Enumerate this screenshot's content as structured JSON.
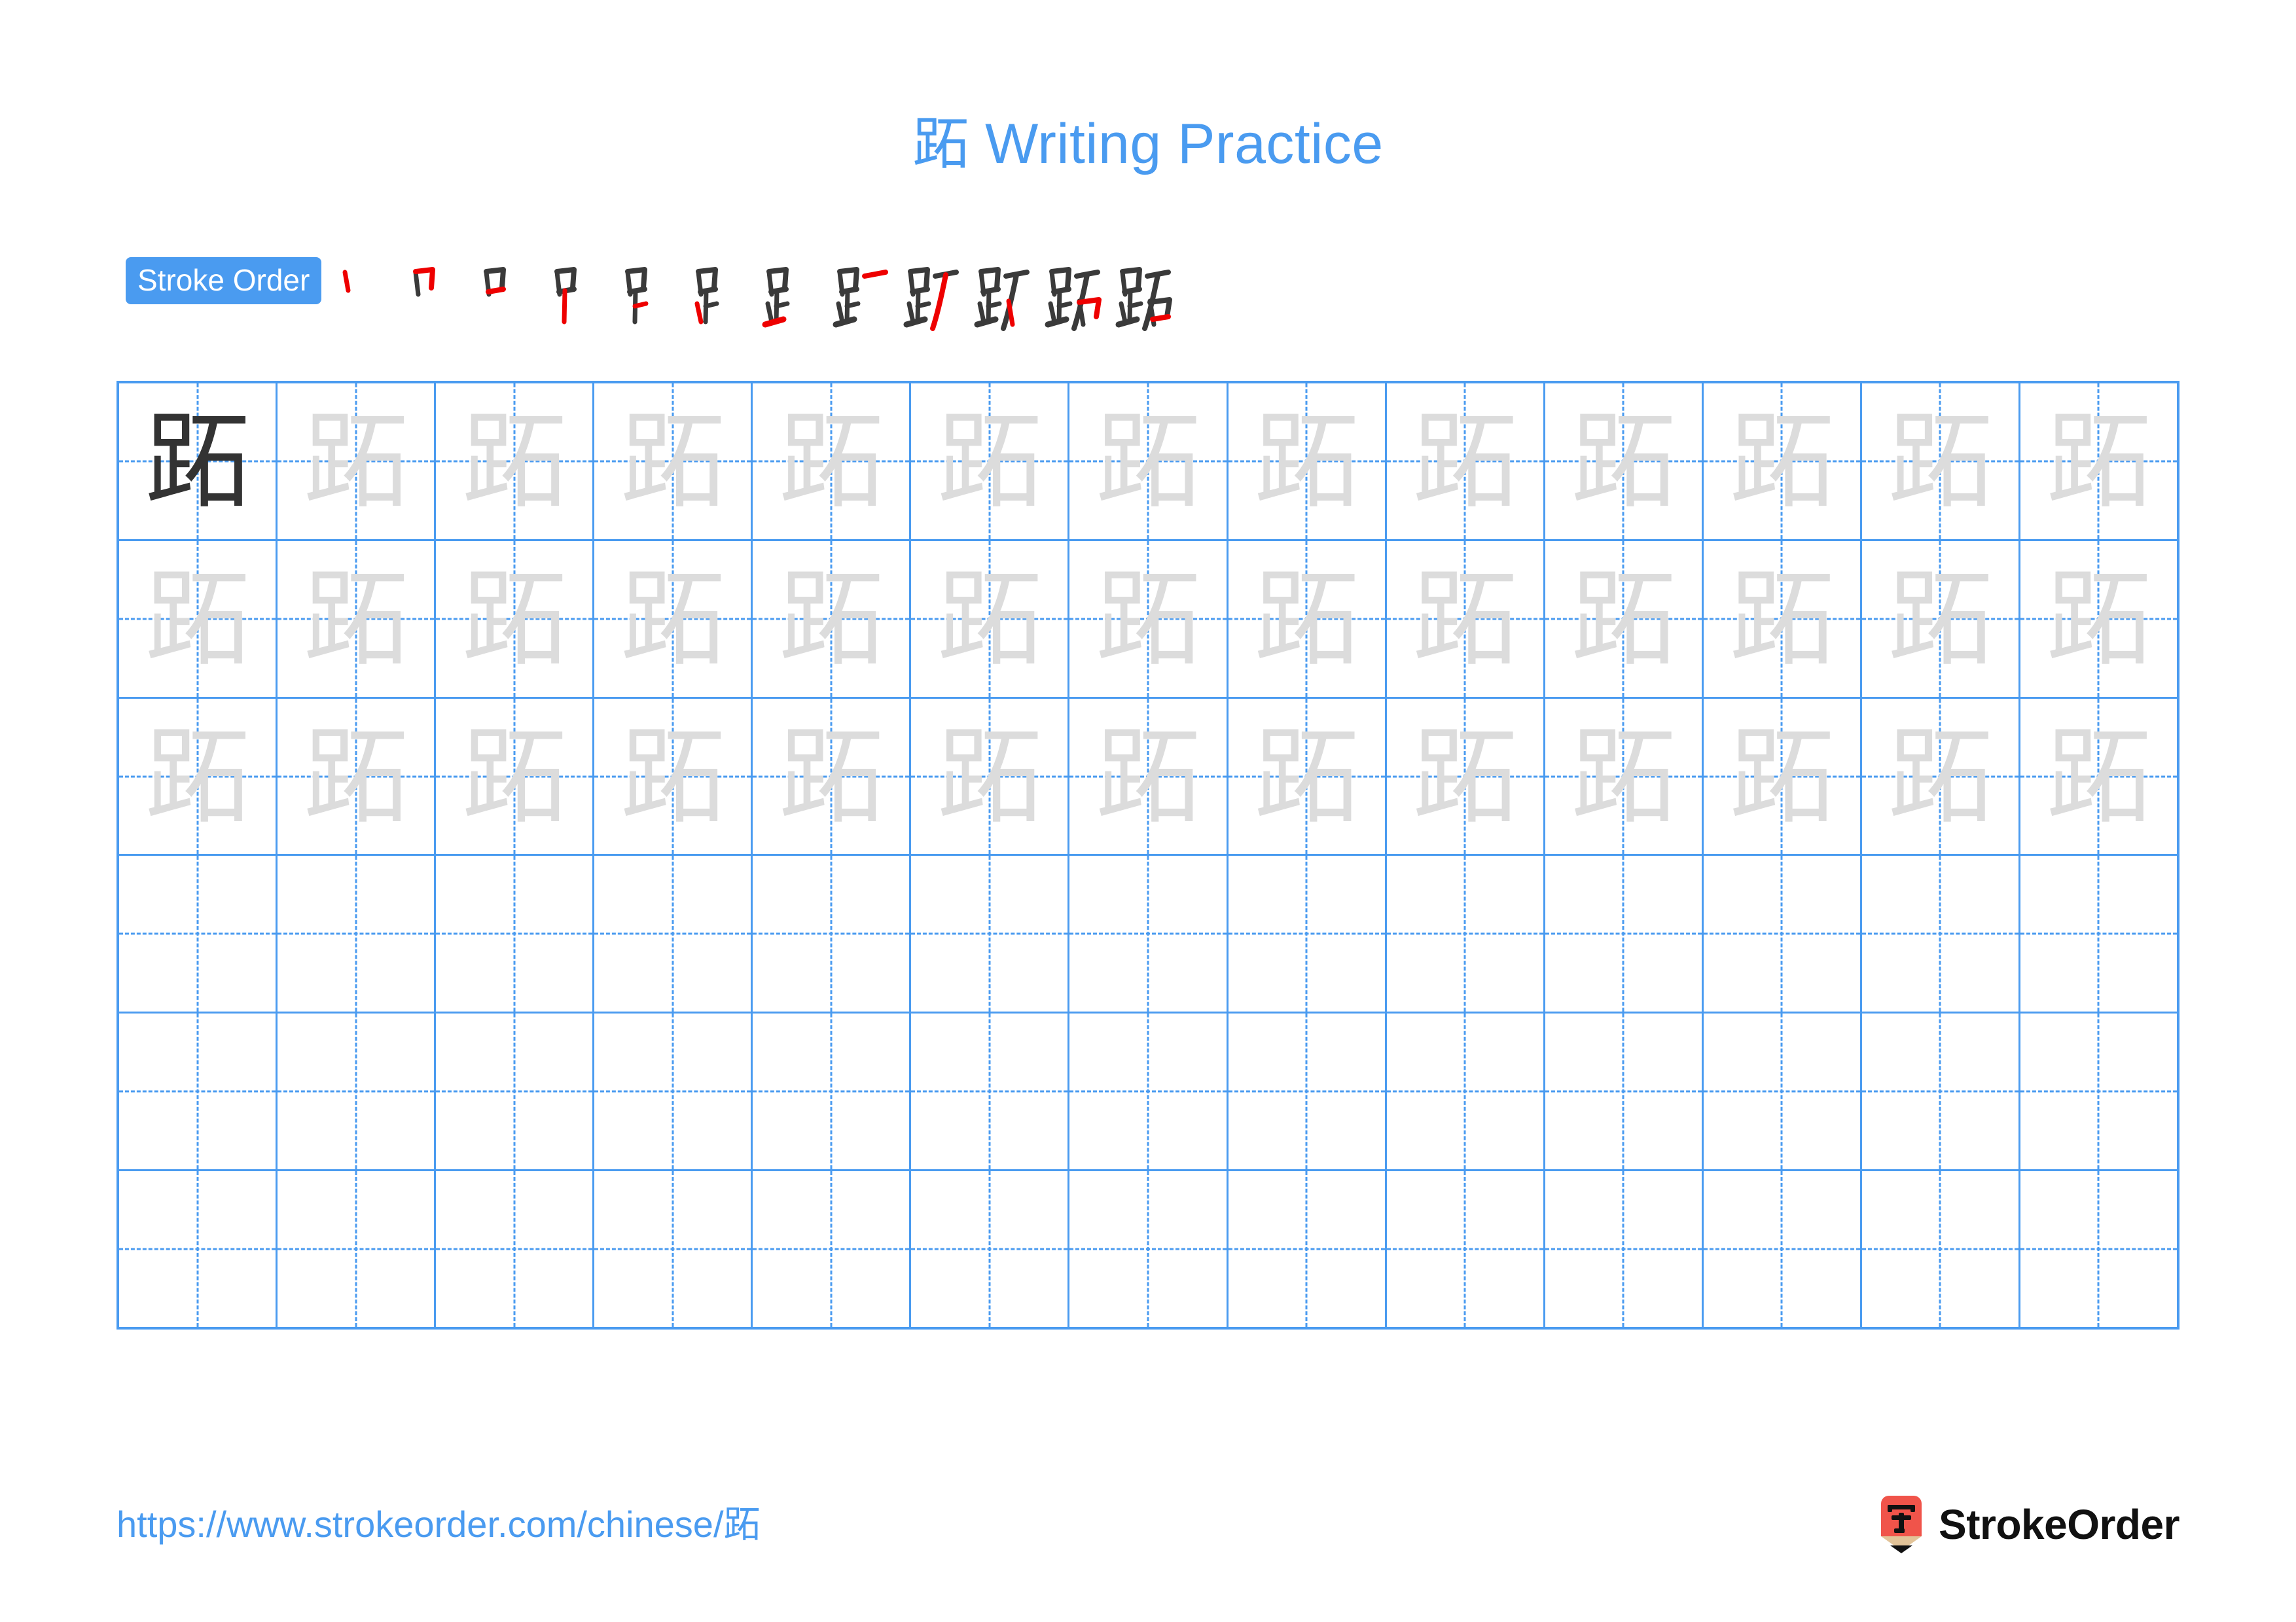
{
  "character": "跖",
  "title": {
    "text": "跖 Writing Practice",
    "char": "跖",
    "suffix": " Writing Practice",
    "color": "#4a9bf0"
  },
  "stroke_order": {
    "badge_label": "Stroke Order",
    "badge_bg": "#4a9bf0",
    "badge_text_color": "#ffffff",
    "stroke_count": 12,
    "new_stroke_color": "#ee0000",
    "existing_stroke_color": "#3a3a3a",
    "steps": [
      {
        "index": 1,
        "label": "stroke-1"
      },
      {
        "index": 2,
        "label": "stroke-2"
      },
      {
        "index": 3,
        "label": "stroke-3"
      },
      {
        "index": 4,
        "label": "stroke-4"
      },
      {
        "index": 5,
        "label": "stroke-5"
      },
      {
        "index": 6,
        "label": "stroke-6"
      },
      {
        "index": 7,
        "label": "stroke-7"
      },
      {
        "index": 8,
        "label": "stroke-8"
      },
      {
        "index": 9,
        "label": "stroke-9"
      },
      {
        "index": 10,
        "label": "stroke-10"
      },
      {
        "index": 11,
        "label": "stroke-11"
      },
      {
        "index": 12,
        "label": "stroke-12"
      }
    ]
  },
  "grid": {
    "rows": 6,
    "columns": 13,
    "line_color": "#4a9bf0",
    "dark_char_color": "#333333",
    "trace_char_color": "#dcdcdc",
    "cells": [
      [
        "dark",
        "light",
        "light",
        "light",
        "light",
        "light",
        "light",
        "light",
        "light",
        "light",
        "light",
        "light",
        "light"
      ],
      [
        "light",
        "light",
        "light",
        "light",
        "light",
        "light",
        "light",
        "light",
        "light",
        "light",
        "light",
        "light",
        "light"
      ],
      [
        "light",
        "light",
        "light",
        "light",
        "light",
        "light",
        "light",
        "light",
        "light",
        "light",
        "light",
        "light",
        "light"
      ],
      [
        "empty",
        "empty",
        "empty",
        "empty",
        "empty",
        "empty",
        "empty",
        "empty",
        "empty",
        "empty",
        "empty",
        "empty",
        "empty"
      ],
      [
        "empty",
        "empty",
        "empty",
        "empty",
        "empty",
        "empty",
        "empty",
        "empty",
        "empty",
        "empty",
        "empty",
        "empty",
        "empty"
      ],
      [
        "empty",
        "empty",
        "empty",
        "empty",
        "empty",
        "empty",
        "empty",
        "empty",
        "empty",
        "empty",
        "empty",
        "empty",
        "empty"
      ]
    ]
  },
  "footer": {
    "url": "https://www.strokeorder.com/chinese/跖",
    "url_prefix": "https://www.strokeorder.com/chinese/",
    "url_char": "跖",
    "url_color": "#4a9bf0",
    "brand_name": "StrokeOrder",
    "brand_logo_char": "字",
    "brand_logo_bg": "#f0544a",
    "brand_logo_tip": "#e2c398"
  }
}
